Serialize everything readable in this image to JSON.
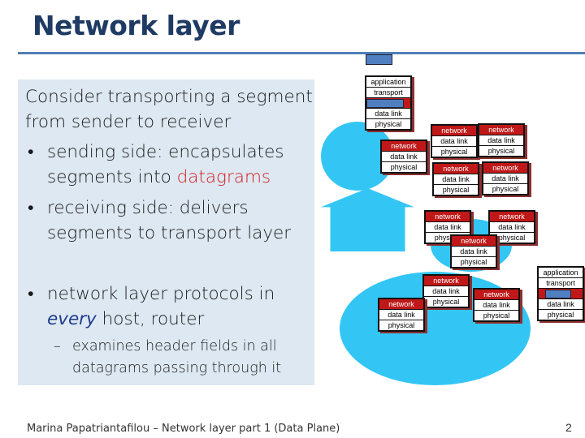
{
  "title": "Network layer",
  "body": {
    "intro_1": "Consider transporting a segment",
    "intro_2": "from sender to receiver",
    "bullet1_a": "sending side: encapsulates",
    "bullet1_b_pre": "segments into ",
    "bullet1_b_hl": "datagrams",
    "bullet2_a": "receiving side: delivers",
    "bullet2_b": "segments to transport layer",
    "bullet3_a": "network layer protocols in",
    "bullet3_b_hl": "every",
    "bullet3_b_post": " host, router",
    "sub_a": "examines header fields in all",
    "sub_b": "datagrams passing through it",
    "bullet_symbol": "•",
    "dash_symbol": "–"
  },
  "layers": {
    "application": "application",
    "transport": "transport",
    "network": "network",
    "datalink": "data link",
    "physical": "physical"
  },
  "colors": {
    "network_layer": "#c01818",
    "datagram": "#4f7fc0",
    "cloud": "#33c6f4",
    "title": "#1f3b64"
  },
  "footer": "Marina Papatriantafilou –  Network layer part 1 (Data Plane)",
  "page_number": "2"
}
